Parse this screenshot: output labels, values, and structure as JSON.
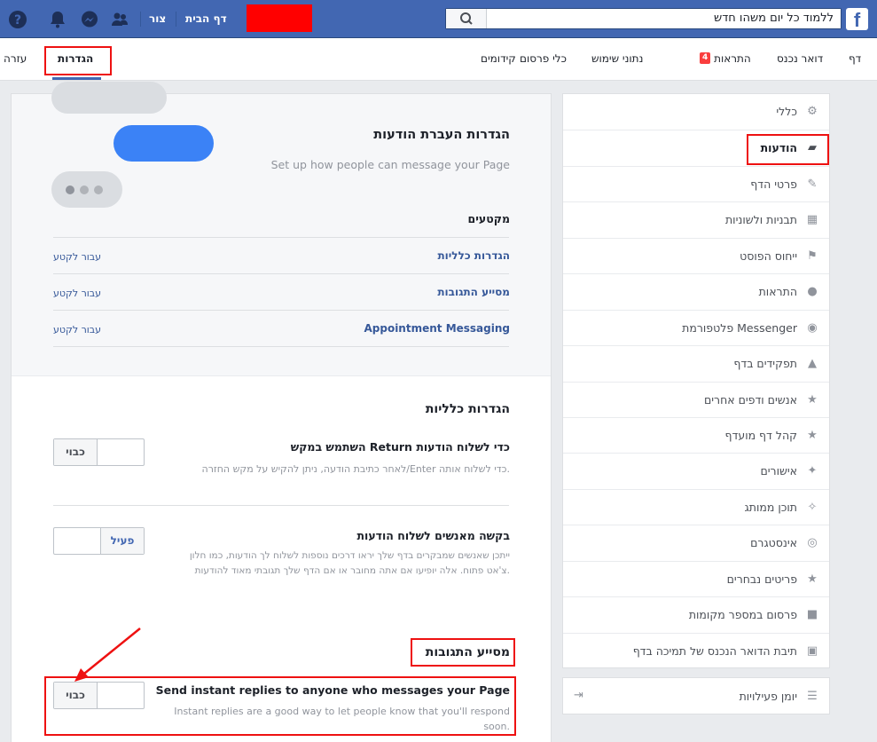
{
  "topbar": {
    "logo": "f",
    "search_value": "ללמוד כל יום משהו חדש",
    "home": "דף הבית",
    "create": "צור"
  },
  "subnav": {
    "tabs": [
      {
        "label": "דף"
      },
      {
        "label": "דואר נכנס"
      },
      {
        "label": "התראות",
        "badge": "4"
      },
      {
        "label": "נתוני שימוש"
      },
      {
        "label": "כלי פרסום"
      },
      {
        "label": "קידומים"
      }
    ],
    "settings": "הגדרות",
    "help": "עזרה"
  },
  "menu": {
    "items": [
      {
        "label": "כללי",
        "icon": "gear-icon"
      },
      {
        "label": "הודעות",
        "icon": "chat-icon"
      },
      {
        "label": "פרטי הדף",
        "icon": "pencil-icon"
      },
      {
        "label": "תבניות ולשוניות",
        "icon": "grid-icon"
      },
      {
        "label": "ייחוס הפוסט",
        "icon": "flag-icon"
      },
      {
        "label": "התראות",
        "icon": "globe-icon"
      },
      {
        "label": "פלטפורמת Messenger",
        "icon": "messenger-icon"
      },
      {
        "label": "תפקידים בדף",
        "icon": "person-icon"
      },
      {
        "label": "אנשים ודפים אחרים",
        "icon": "person-star-icon"
      },
      {
        "label": "קהל דף מועדף",
        "icon": "person-star-icon"
      },
      {
        "label": "אישורים",
        "icon": "wrench-icon"
      },
      {
        "label": "תוכן ממותג",
        "icon": "handshake-icon"
      },
      {
        "label": "אינסטגרם",
        "icon": "instagram-icon"
      },
      {
        "label": "פריטים נבחרים",
        "icon": "star-icon"
      },
      {
        "label": "פרסום במספר מקומות",
        "icon": "video-icon"
      },
      {
        "label": "תיבת הדואר הנכנס של תמיכה בדף",
        "icon": "facebook-icon"
      }
    ],
    "activity_log": "יומן פעילויות"
  },
  "main": {
    "header_title": "הגדרות העברת הודעות",
    "header_sub": "Set up how people can message your Page",
    "sections_title": "מקטעים",
    "sections": [
      {
        "label": "הגדרות כלליות",
        "goto": "עבור לקטע"
      },
      {
        "label": "מסייע התגובות",
        "goto": "עבור לקטע"
      },
      {
        "label": "Appointment Messaging",
        "goto": "עבור לקטע"
      }
    ],
    "general_title": "הגדרות כלליות",
    "setting1_title": "השתמש במקש Return כדי לשלוח הודעות",
    "setting1_desc": "לאחר כתיבת הודעה, ניתן להקיש על מקש החזרה/Enter כדי לשלוח אותה.",
    "setting1_toggle": "כבוי",
    "setting2_title": "בקשה מאנשים לשלוח הודעות",
    "setting2_desc_1": "ייתכן שאנשים שמבקרים בדף שלך יראו דרכים נוספות לשלוח לך הודעות, כמו חלון",
    "setting2_desc_2": "צ'אט פתוח. אלה יופיעו אם אתה מחובר או אם הדף שלך תגובתי מאוד להודעות.",
    "setting2_toggle": "פעיל",
    "assistant_title": "מסייע התגובות",
    "setting3_title": "Send instant replies to anyone who messages your Page",
    "setting3_desc_1": "Instant replies are a good way to let people know that you'll respond",
    "setting3_desc_2": "soon.",
    "setting3_toggle": "כבוי"
  }
}
